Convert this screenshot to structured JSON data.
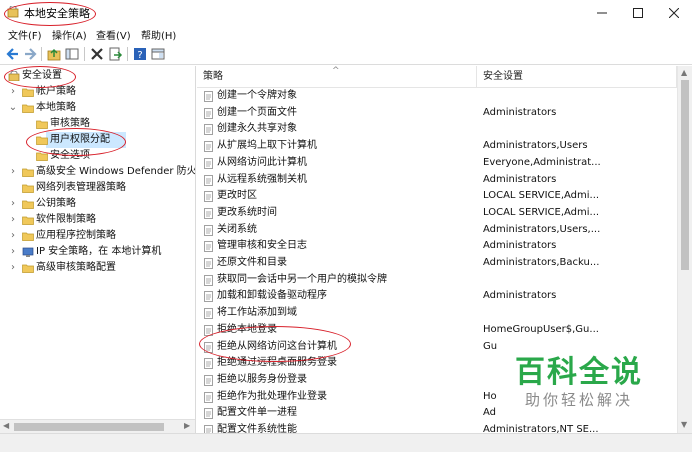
{
  "window": {
    "title": "本地安全策略"
  },
  "menu": [
    "文件(F)",
    "操作(A)",
    "查看(V)",
    "帮助(H)"
  ],
  "toolbar_icons": [
    "back-arrow-icon",
    "forward-arrow-icon",
    "up-folder-icon",
    "show-hide-tree-icon",
    "delete-icon",
    "export-icon",
    "help-icon",
    "properties-icon"
  ],
  "tree": [
    {
      "label": "安全设置",
      "indent": 0,
      "arrow": "",
      "icon": "security-settings-icon"
    },
    {
      "label": "帐户策略",
      "indent": 1,
      "arrow": "›",
      "icon": "folder-icon"
    },
    {
      "label": "本地策略",
      "indent": 1,
      "arrow": "⌄",
      "icon": "folder-open-icon"
    },
    {
      "label": "审核策略",
      "indent": 2,
      "arrow": "",
      "icon": "folder-icon"
    },
    {
      "label": "用户权限分配",
      "indent": 2,
      "arrow": "",
      "icon": "folder-icon",
      "selected": true
    },
    {
      "label": "安全选项",
      "indent": 2,
      "arrow": "",
      "icon": "folder-icon"
    },
    {
      "label": "高级安全 Windows Defender 防火墙",
      "indent": 1,
      "arrow": "›",
      "icon": "folder-icon"
    },
    {
      "label": "网络列表管理器策略",
      "indent": 1,
      "arrow": "",
      "icon": "folder-icon"
    },
    {
      "label": "公钥策略",
      "indent": 1,
      "arrow": "›",
      "icon": "folder-icon"
    },
    {
      "label": "软件限制策略",
      "indent": 1,
      "arrow": "›",
      "icon": "folder-icon"
    },
    {
      "label": "应用程序控制策略",
      "indent": 1,
      "arrow": "›",
      "icon": "folder-icon"
    },
    {
      "label": "IP 安全策略，在 本地计算机",
      "indent": 1,
      "arrow": "›",
      "icon": "ip-security-icon"
    },
    {
      "label": "高级审核策略配置",
      "indent": 1,
      "arrow": "›",
      "icon": "folder-icon"
    }
  ],
  "list": {
    "columns": {
      "policy": "策略",
      "setting": "安全设置"
    },
    "rows": [
      {
        "policy": "创建一个令牌对象",
        "setting": ""
      },
      {
        "policy": "创建一个页面文件",
        "setting": "Administrators"
      },
      {
        "policy": "创建永久共享对象",
        "setting": ""
      },
      {
        "policy": "从扩展坞上取下计算机",
        "setting": "Administrators,Users"
      },
      {
        "policy": "从网络访问此计算机",
        "setting": "Everyone,Administrat..."
      },
      {
        "policy": "从远程系统强制关机",
        "setting": "Administrators"
      },
      {
        "policy": "更改时区",
        "setting": "LOCAL SERVICE,Admi..."
      },
      {
        "policy": "更改系统时间",
        "setting": "LOCAL SERVICE,Admi..."
      },
      {
        "policy": "关闭系统",
        "setting": "Administrators,Users,..."
      },
      {
        "policy": "管理审核和安全日志",
        "setting": "Administrators"
      },
      {
        "policy": "还原文件和目录",
        "setting": "Administrators,Backu..."
      },
      {
        "policy": "获取同一会话中另一个用户的模拟令牌",
        "setting": ""
      },
      {
        "policy": "加载和卸载设备驱动程序",
        "setting": "Administrators"
      },
      {
        "policy": "将工作站添加到域",
        "setting": ""
      },
      {
        "policy": "拒绝本地登录",
        "setting": "HomeGroupUser$,Gu..."
      },
      {
        "policy": "拒绝从网络访问这台计算机",
        "setting": "Gu"
      },
      {
        "policy": "拒绝通过远程桌面服务登录",
        "setting": ""
      },
      {
        "policy": "拒绝以服务身份登录",
        "setting": ""
      },
      {
        "policy": "拒绝作为批处理作业登录",
        "setting": "Ho"
      },
      {
        "policy": "配置文件单一进程",
        "setting": "Ad"
      },
      {
        "policy": "配置文件系统性能",
        "setting": "Administrators,NT SE..."
      }
    ]
  },
  "watermark": {
    "title": "百科全说",
    "subtitle": "助你轻松解决"
  },
  "colors": {
    "annotation": "#d8202a",
    "watermark": "#2aa84a",
    "selection": "#cce8ff"
  }
}
